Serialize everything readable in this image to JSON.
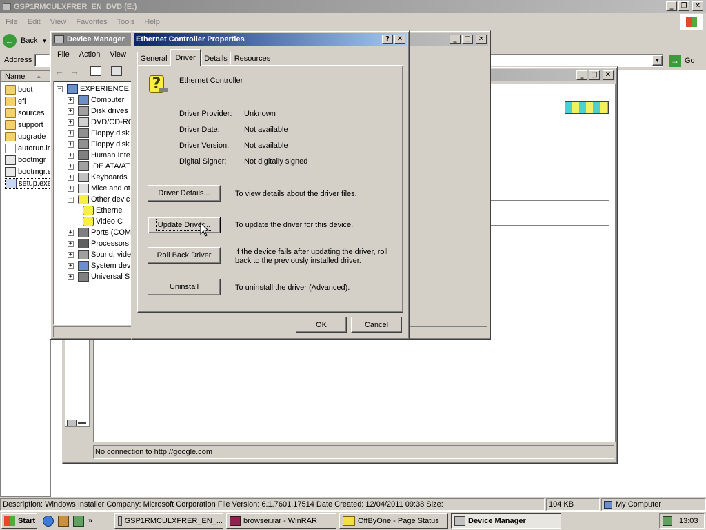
{
  "explorer": {
    "title": "GSP1RMCULXFRER_EN_DVD (E:)",
    "menu": [
      "File",
      "Edit",
      "View",
      "Favorites",
      "Tools",
      "Help"
    ],
    "back_label": "Back",
    "address_label": "Address",
    "go_label": "Go",
    "column_name": "Name",
    "files": [
      "boot",
      "efi",
      "sources",
      "support",
      "upgrade",
      "autorun.ir",
      "bootmgr",
      "bootmgr.e",
      "setup.exe"
    ],
    "status_description": "Description: Windows Installer Company: Microsoft Corporation File Version: 6.1.7601.17514 Date Created: 12/04/2011 09:38 Size:",
    "status_size": "104 KB",
    "status_zone": "My Computer"
  },
  "browser_window": {
    "status_text": "No connection to http://google.com"
  },
  "device_manager": {
    "title": "Device Manager",
    "menu": [
      "File",
      "Action",
      "View"
    ],
    "root": "EXPERIENCE",
    "items": [
      {
        "label": "Computer",
        "icon": "computer-icon"
      },
      {
        "label": "Disk drives",
        "icon": "disk-icon"
      },
      {
        "label": "DVD/CD-RC",
        "icon": "cdrom-icon"
      },
      {
        "label": "Floppy disk",
        "icon": "floppy-icon"
      },
      {
        "label": "Floppy disk",
        "icon": "floppy-icon"
      },
      {
        "label": "Human Inte",
        "icon": "hid-icon"
      },
      {
        "label": "IDE ATA/AT",
        "icon": "ide-icon"
      },
      {
        "label": "Keyboards",
        "icon": "keyboard-icon"
      },
      {
        "label": "Mice and ot",
        "icon": "mouse-icon"
      },
      {
        "label": "Other devic",
        "icon": "unknown-device-icon"
      },
      {
        "label": "Etherne",
        "icon": "unknown-device-icon"
      },
      {
        "label": "Video C",
        "icon": "unknown-device-icon"
      },
      {
        "label": "Ports (COM",
        "icon": "port-icon"
      },
      {
        "label": "Processors",
        "icon": "cpu-icon"
      },
      {
        "label": "Sound, vide",
        "icon": "sound-icon"
      },
      {
        "label": "System dev",
        "icon": "system-icon"
      },
      {
        "label": "Universal S",
        "icon": "usb-icon"
      }
    ]
  },
  "dialog": {
    "title": "Ethernet Controller Properties",
    "tabs": [
      "General",
      "Driver",
      "Details",
      "Resources"
    ],
    "active_tab": "Driver",
    "device_name": "Ethernet Controller",
    "fields": [
      {
        "label": "Driver Provider:",
        "value": "Unknown"
      },
      {
        "label": "Driver Date:",
        "value": "Not available"
      },
      {
        "label": "Driver Version:",
        "value": "Not available"
      },
      {
        "label": "Digital Signer:",
        "value": "Not digitally signed"
      }
    ],
    "actions": [
      {
        "button": "Driver Details...",
        "desc": "To view details about the driver files."
      },
      {
        "button": "Update Driver...",
        "desc": "To update the driver for this device."
      },
      {
        "button": "Roll Back Driver",
        "desc": "If the device fails after updating the driver, roll back to the previously installed driver."
      },
      {
        "button": "Uninstall",
        "desc": "To uninstall the driver (Advanced)."
      }
    ],
    "ok_label": "OK",
    "cancel_label": "Cancel"
  },
  "taskbar": {
    "start_label": "Start",
    "tasks": [
      {
        "label": "GSP1RMCULXFRER_EN_...",
        "icon": "folder-icon"
      },
      {
        "label": "browser.rar - WinRAR",
        "icon": "winrar-icon"
      },
      {
        "label": "OffByOne - Page Status",
        "icon": "offbyone-icon"
      },
      {
        "label": "Device Manager",
        "icon": "device-manager-icon"
      }
    ],
    "clock": "13:03"
  },
  "colors": {
    "title_active": "#0a246a",
    "title_inactive": "#808080",
    "face": "#d4d0c8"
  }
}
